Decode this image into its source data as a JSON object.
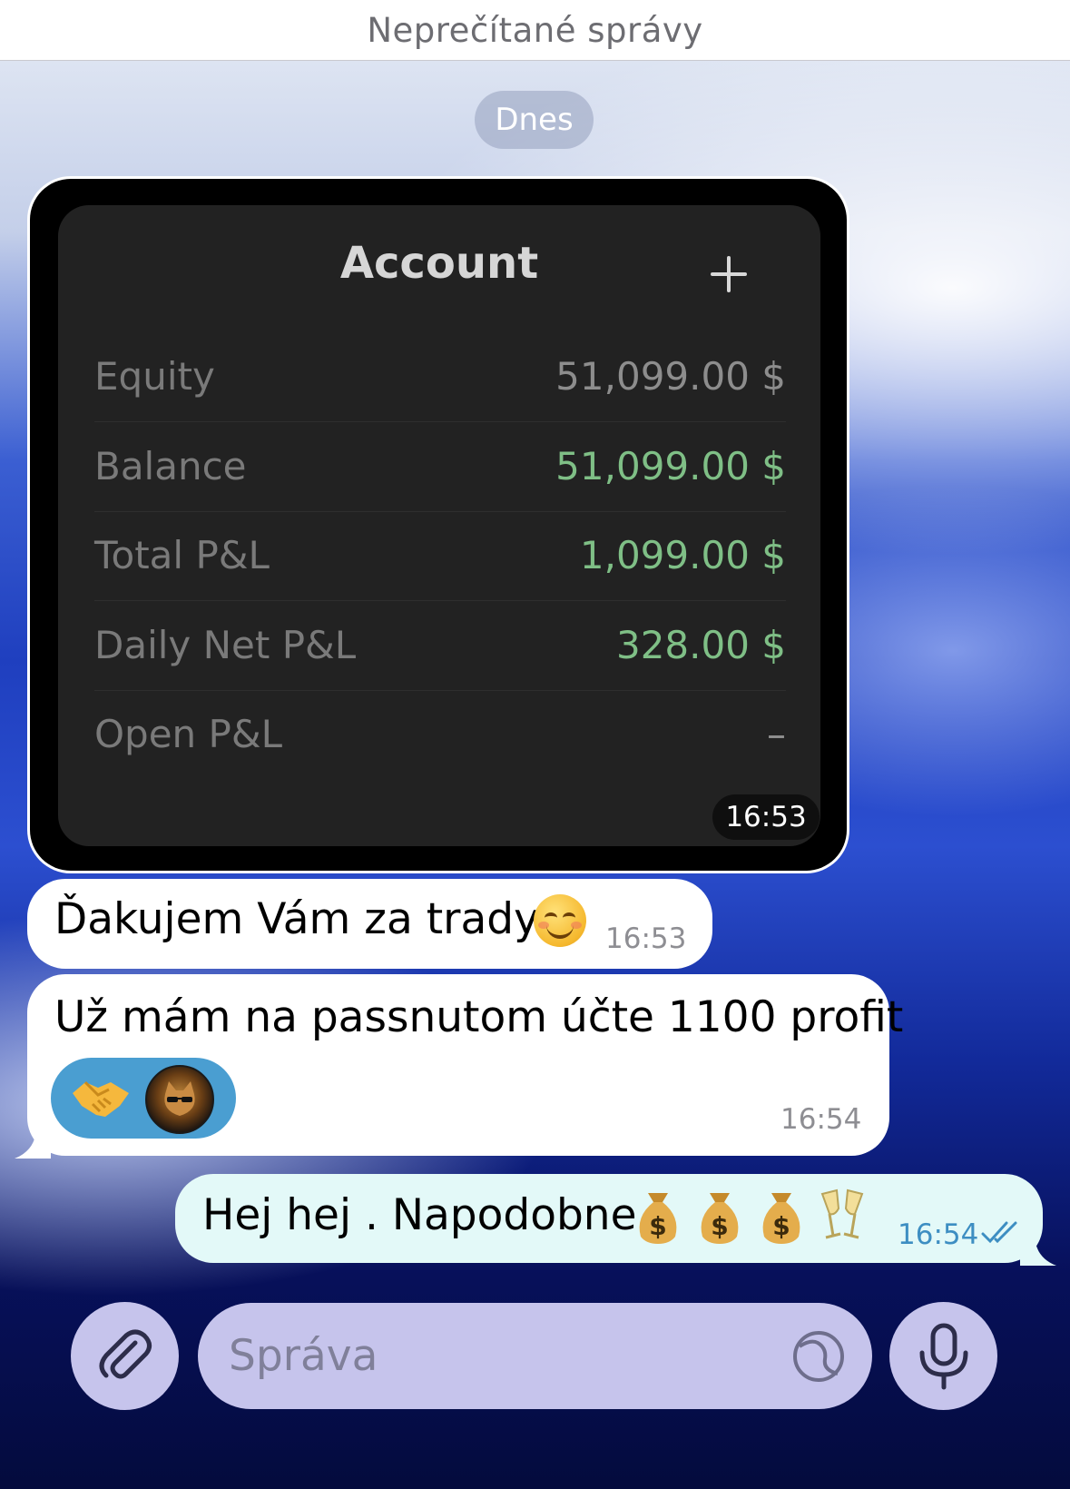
{
  "header": {
    "unread_title": "Neprečítané správy"
  },
  "chat": {
    "date_separator": "Dnes",
    "messages": [
      {
        "type": "image",
        "account_card": {
          "title": "Account",
          "rows": [
            {
              "label": "Equity",
              "value": "51,099.00 $",
              "color": "gray"
            },
            {
              "label": "Balance",
              "value": "51,099.00 $",
              "color": "green"
            },
            {
              "label": "Total P&L",
              "value": "1,099.00 $",
              "color": "green"
            },
            {
              "label": "Daily Net P&L",
              "value": "328.00 $",
              "color": "green"
            },
            {
              "label": "Open P&L",
              "value": "–",
              "color": "gray"
            }
          ]
        },
        "time": "16:53"
      },
      {
        "type": "text",
        "text": "Ďakujem Vám za trady",
        "emoji": "smiling-face-icon",
        "time": "16:53"
      },
      {
        "type": "text",
        "text": "Už mám na passnutom účte 1100 profit",
        "reaction": "handshake-icon",
        "time": "16:54"
      },
      {
        "type": "text",
        "direction": "outgoing",
        "text": "Hej hej . Napodobne",
        "emojis": [
          "money-bag-icon",
          "money-bag-icon",
          "money-bag-icon",
          "champagne-glasses-icon"
        ],
        "time": "16:54",
        "status": "read"
      }
    ]
  },
  "composer": {
    "placeholder": "Správa",
    "attach_icon": "paperclip-icon",
    "sticker_icon": "sticker-icon",
    "mic_icon": "microphone-icon"
  },
  "colors": {
    "green_value": "#7fbf86",
    "outgoing_bubble": "#e3f9f8",
    "composer": "#c6c4ec",
    "reaction_pill": "#4a9ed1",
    "outgoing_time": "#3d8ec2"
  }
}
